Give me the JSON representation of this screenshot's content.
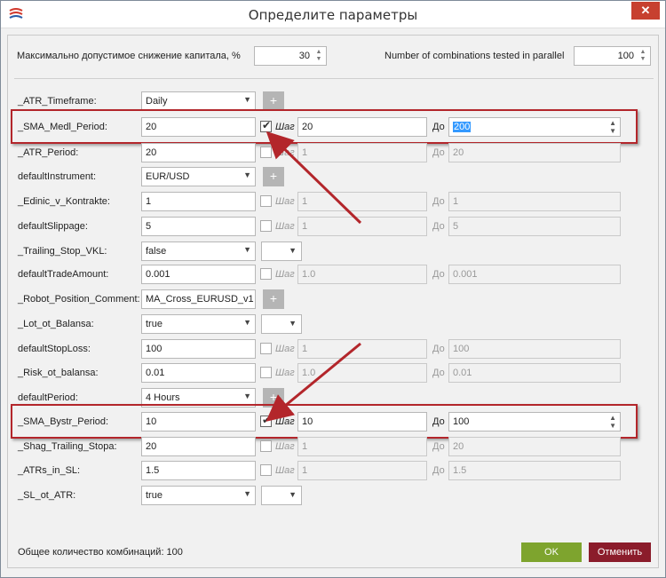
{
  "window": {
    "title": "Определите параметры",
    "close_glyph": "✕",
    "accent": "#c7402f"
  },
  "top": {
    "drawdown_label": "Максимально допустимое снижение капитала, %",
    "drawdown_value": "30",
    "parallel_label": "Number of combinations tested in parallel",
    "parallel_value": "100"
  },
  "labels": {
    "step": "Шаг",
    "to": "До",
    "plus": "+"
  },
  "rows": [
    {
      "name": "_ATR_Timeframe:",
      "value": "Daily",
      "kind": "combo-plus"
    },
    {
      "name": "_SMA_Medl_Period:",
      "value": "20",
      "kind": "range",
      "checked": true,
      "step": "20",
      "to": "200",
      "highlight": true
    },
    {
      "name": "_ATR_Period:",
      "value": "20",
      "kind": "range",
      "checked": false,
      "step": "1",
      "to": "20"
    },
    {
      "name": "defaultInstrument:",
      "value": "EUR/USD",
      "kind": "combo-plus"
    },
    {
      "name": "_Edinic_v_Kontrakte:",
      "value": "1",
      "kind": "range",
      "checked": false,
      "step": "1",
      "to": "1"
    },
    {
      "name": "defaultSlippage:",
      "value": "5",
      "kind": "range",
      "checked": false,
      "step": "1",
      "to": "5"
    },
    {
      "name": "_Trailing_Stop_VKL:",
      "value": "false",
      "kind": "combo-mini"
    },
    {
      "name": "defaultTradeAmount:",
      "value": "0.001",
      "kind": "range",
      "checked": false,
      "step": "1.0",
      "to": "0.001"
    },
    {
      "name": "_Robot_Position_Comment:",
      "value": "MA_Cross_EURUSD_v1",
      "kind": "text-plus"
    },
    {
      "name": "_Lot_ot_Balansa:",
      "value": "true",
      "kind": "combo-mini"
    },
    {
      "name": "defaultStopLoss:",
      "value": "100",
      "kind": "range",
      "checked": false,
      "step": "1",
      "to": "100"
    },
    {
      "name": "_Risk_ot_balansa:",
      "value": "0.01",
      "kind": "range",
      "checked": false,
      "step": "1.0",
      "to": "0.01"
    },
    {
      "name": "defaultPeriod:",
      "value": "4 Hours",
      "kind": "combo-plus"
    },
    {
      "name": "_SMA_Bystr_Period:",
      "value": "10",
      "kind": "range",
      "checked": true,
      "step": "10",
      "to": "100",
      "highlight": true
    },
    {
      "name": "_Shag_Trailing_Stopa:",
      "value": "20",
      "kind": "range",
      "checked": false,
      "step": "1",
      "to": "20"
    },
    {
      "name": "_ATRs_in_SL:",
      "value": "1.5",
      "kind": "range",
      "checked": false,
      "step": "1",
      "to": "1.5"
    },
    {
      "name": "_SL_ot_ATR:",
      "value": "true",
      "kind": "combo-mini"
    }
  ],
  "footer": {
    "total": "Общее количество комбинаций: 100",
    "ok": "OK",
    "cancel": "Отменить",
    "ok_color": "#7ea42e",
    "cancel_color": "#8b1c2b"
  },
  "annotations": {
    "highlight_color": "#b3262b"
  }
}
